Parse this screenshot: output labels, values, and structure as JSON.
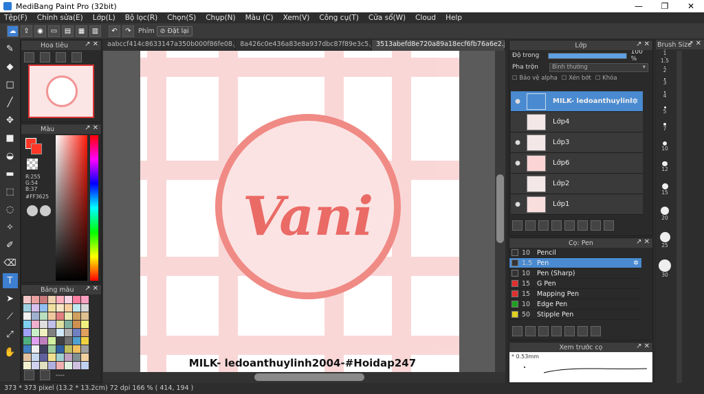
{
  "app": {
    "title": "MediBang Paint Pro (32bit)"
  },
  "window_controls": [
    "—",
    "❐",
    "✕"
  ],
  "menu": [
    "Tệp(F)",
    "Chỉnh sửa(E)",
    "Lớp(L)",
    "Bộ lọc(R)",
    "Chọn(S)",
    "Chụp(N)",
    "Màu (C)",
    "Xem(V)",
    "Công cụ(T)",
    "Cửa sổ(W)",
    "Cloud",
    "Help"
  ],
  "toolbar": {
    "phim_label": "Phím",
    "reset_label": "Đặt lại"
  },
  "tabs": [
    {
      "label": "aabccf414c8633147a350b000f86fe08.jpg"
    },
    {
      "label": "8a426c0e436a83e8a937dbc87f89e3c5.jpg"
    },
    {
      "label": "3513abefd8e720a89a18ecf6fb76a6e2.jpg"
    }
  ],
  "navigator": {
    "title": "Hoa tiêu"
  },
  "color_panel": {
    "title": "Màu",
    "r": "R:255",
    "g": "G:54",
    "b": "B:37",
    "hex": "#FF3625",
    "primary_color": "#ff3625"
  },
  "palette": {
    "title": "Bảng màu",
    "footer": "----",
    "colors": [
      "#f3c7c7",
      "#e8a0a0",
      "#c87a7a",
      "#f0d0b0",
      "#ffb0c0",
      "#f7d4e4",
      "#ff7fa0",
      "#f7a0c0",
      "#a0d0e0",
      "#d8c0f0",
      "#90c0f0",
      "#f0e0a0",
      "#f7e7c7",
      "#f8d0a0",
      "#c0e8f0",
      "#d8d8d8",
      "#f0f0f0",
      "#a0b0d0",
      "#b8e0c0",
      "#f0c8a0",
      "#e08080",
      "#e8e8b0",
      "#d0a060",
      "#e0c090",
      "#80d0f0",
      "#f0b0d0",
      "#e0e0e0",
      "#c0c0e8",
      "#e0e0a0",
      "#80b0a0",
      "#d09050",
      "#f0f080",
      "#a0a0ff",
      "#c8f0c8",
      "#f0f0c0",
      "#808080",
      "#d0e8f8",
      "#b0b0b0",
      "#7080c0",
      "#e0a060",
      "#50b080",
      "#e0a0f0",
      "#c080c0",
      "#d0f0a0",
      "#404040",
      "#707070",
      "#50a0d0",
      "#f0d040",
      "#4080c0",
      "#f0f0f0",
      "#404060",
      "#a0d0a0",
      "#3060a0",
      "#c0c060",
      "#f0c060",
      "#a0a0a0",
      "#e0c0a0",
      "#c8d8f0",
      "#6060a0",
      "#f0e090",
      "#a0d0d0",
      "#c0a0c0",
      "#809090",
      "#f0d0a0",
      "#f0f0d0",
      "#d0d0f0",
      "#e0e0c0",
      "#b0b0e0",
      "#f0b0b0",
      "#e0f0e0",
      "#d0c0e0",
      "#c0d0f0"
    ]
  },
  "canvas": {
    "signature": "MILK- ledoanthuylinh2004-#Hoidap247",
    "logo_text": "Vani"
  },
  "layers": {
    "title": "Lớp",
    "opacity_label": "Độ trong",
    "opacity_value": "100 %",
    "opacity": 1.0,
    "blend_label": "Pha trộn",
    "blend_value": "Bình thường",
    "protect_alpha": "Bảo vệ alpha",
    "clipping": "Xén bớt",
    "lock": "Khóa",
    "items": [
      {
        "name": "MILK- ledoanthuylinh2004-#Hoidap247",
        "selected": true
      },
      {
        "name": "Lớp4",
        "selected": false
      },
      {
        "name": "Lớp3",
        "selected": false
      },
      {
        "name": "Lớp6",
        "selected": false
      },
      {
        "name": "Lớp2",
        "selected": false
      },
      {
        "name": "Lớp1",
        "selected": false
      }
    ]
  },
  "brushes": {
    "title": "Cọ: Pen",
    "items": [
      {
        "size": "10",
        "name": "Pencil",
        "color": "#333333",
        "selected": false
      },
      {
        "size": "1.5",
        "name": "Pen",
        "color": "#333333",
        "selected": true
      },
      {
        "size": "10",
        "name": "Pen (Sharp)",
        "color": "#333333",
        "selected": false
      },
      {
        "size": "15",
        "name": "G Pen",
        "color": "#e03030",
        "selected": false
      },
      {
        "size": "15",
        "name": "Mapping Pen",
        "color": "#e03030",
        "selected": false
      },
      {
        "size": "10",
        "name": "Edge Pen",
        "color": "#20a020",
        "selected": false
      },
      {
        "size": "50",
        "name": "Stipple Pen",
        "color": "#e0d020",
        "selected": false
      }
    ]
  },
  "preview": {
    "title": "Xem trước cọ",
    "size": "0.53mm"
  },
  "brush_size": {
    "title": "Brush Size",
    "items": [
      "1",
      "1.5",
      "2",
      "3",
      "4",
      "5",
      "7",
      "10",
      "12",
      "15",
      "20",
      "25",
      "30"
    ]
  },
  "status": {
    "text": "373 * 373 pixel  (13.2 * 13.2cm)  72 dpi  166 %  ( 414, 194 )"
  }
}
